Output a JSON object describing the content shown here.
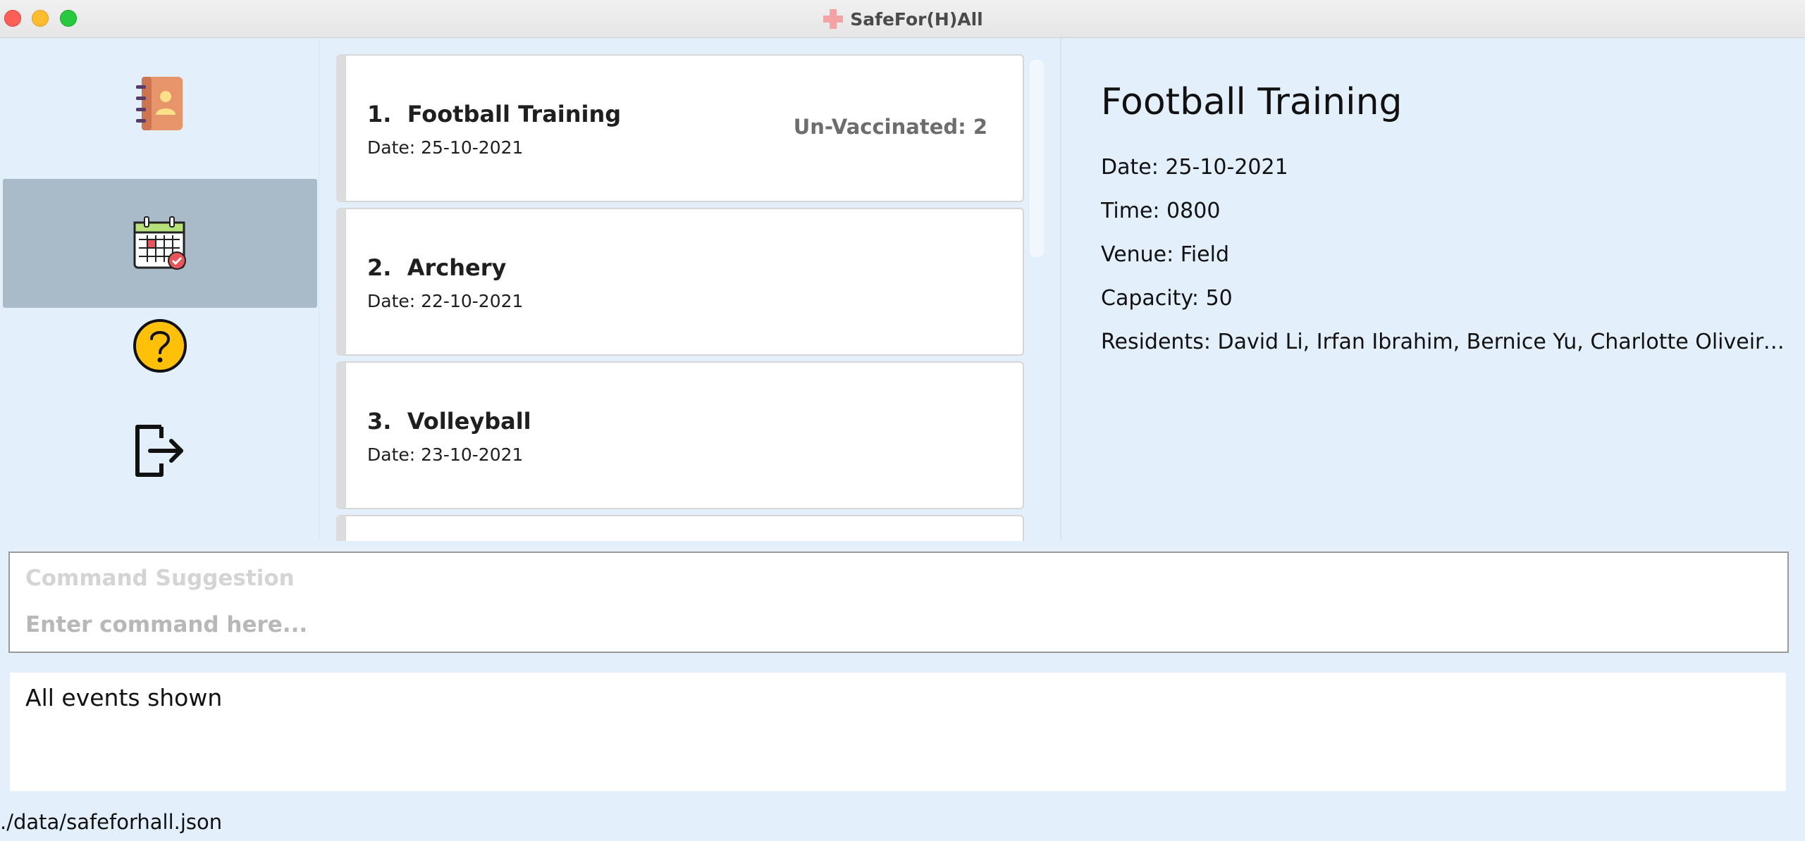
{
  "window": {
    "title": "SafeFor(H)All"
  },
  "sidebar": {
    "items": [
      {
        "icon": "residents-addressbook-icon",
        "active": false
      },
      {
        "icon": "events-calendar-icon",
        "active": true
      },
      {
        "icon": "help-question-icon",
        "active": false
      },
      {
        "icon": "exit-icon",
        "active": false
      }
    ]
  },
  "events": [
    {
      "index": "1.",
      "name": "Football Training",
      "date": "Date: 25-10-2021",
      "badge": "Un-Vaccinated: 2"
    },
    {
      "index": "2.",
      "name": "Archery",
      "date": "Date: 22-10-2021",
      "badge": ""
    },
    {
      "index": "3.",
      "name": "Volleyball",
      "date": "Date: 23-10-2021",
      "badge": ""
    }
  ],
  "detail": {
    "title": "Football Training",
    "date": "Date: 25-10-2021",
    "time": "Time: 0800",
    "venue": "Venue: Field",
    "capacity": "Capacity: 50",
    "residents": "Residents: David Li, Irfan Ibrahim, Bernice Yu, Charlotte Oliveiro, Ro..."
  },
  "command": {
    "suggestion_placeholder": "Command Suggestion",
    "input_placeholder": "Enter command here..."
  },
  "result": {
    "text": "All events shown"
  },
  "status": {
    "file_path": "./data/safeforhall.json"
  },
  "colors": {
    "background": "#e3f0fc",
    "sidebar_active": "#a9bac9",
    "card_bg": "#ffffff",
    "badge_text": "#6d6d6d"
  }
}
